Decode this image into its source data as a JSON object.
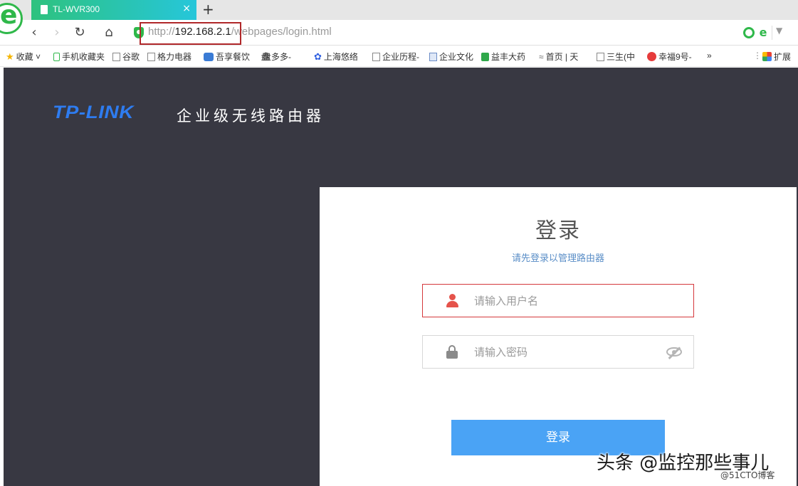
{
  "browser": {
    "tab": {
      "title": "TL-WVR300",
      "close": "×"
    },
    "new_tab": "+",
    "nav": {
      "back": "‹",
      "forward": "›",
      "refresh": "↻",
      "home": "⌂"
    },
    "url": {
      "scheme": "http://",
      "host": "192.168.2.1",
      "path": "/webpages/login.html"
    },
    "bookmarks": [
      {
        "label": "收藏",
        "icon": "star-icon"
      },
      {
        "label": "手机收藏夹",
        "icon": "phone-icon"
      },
      {
        "label": "谷歌",
        "icon": "page-icon"
      },
      {
        "label": "格力电器",
        "icon": "page-icon"
      },
      {
        "label": "吾享餐饮",
        "icon": "cloud-icon"
      },
      {
        "label": "盘多多-",
        "icon": "pdd-icon"
      },
      {
        "label": "上海悠络",
        "icon": "baidu-icon"
      },
      {
        "label": "企业历程-",
        "icon": "page-icon"
      },
      {
        "label": "企业文化",
        "icon": "image-icon"
      },
      {
        "label": "益丰大药",
        "icon": "yifeng-icon"
      },
      {
        "label": "首页 | 天",
        "icon": "ie-icon"
      },
      {
        "label": "三生(中",
        "icon": "page-icon"
      },
      {
        "label": "幸福9号-",
        "icon": "xingfu-icon"
      }
    ],
    "bookmarks_more": "»",
    "extensions_label": "扩展"
  },
  "page": {
    "brand_logo": "TP-LINK",
    "brand_subtitle": "企业级无线路由器",
    "login": {
      "title": "登录",
      "subtitle": "请先登录以管理路由器",
      "username_placeholder": "请输入用户名",
      "password_placeholder": "请输入密码",
      "button_label": "登录"
    }
  },
  "watermark": {
    "main": "头条 @监控那些事儿",
    "sub": "@51CTO博客"
  }
}
